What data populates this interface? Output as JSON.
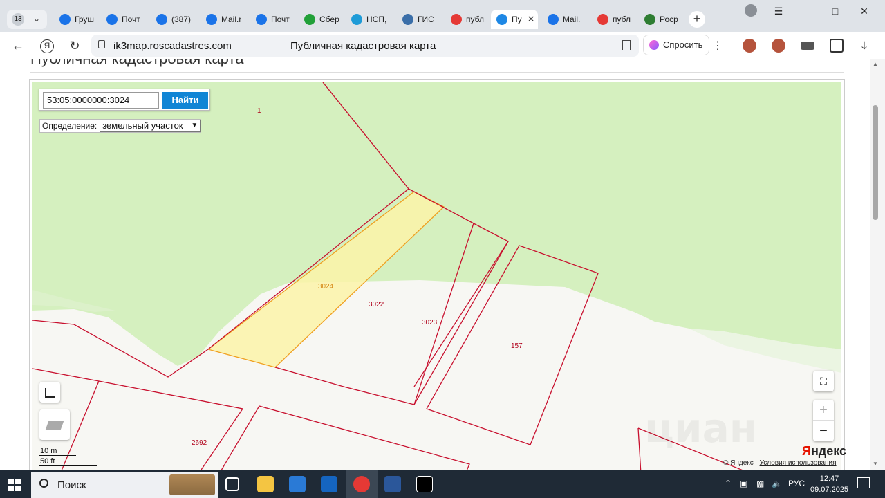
{
  "browser": {
    "tab_count": "13",
    "tabs": [
      {
        "label": "Груш",
        "color": "#1a73e8"
      },
      {
        "label": "Почт",
        "color": "#1a73e8"
      },
      {
        "label": "(387)",
        "color": "#1a73e8"
      },
      {
        "label": "Mail.r",
        "color": "#1a73e8"
      },
      {
        "label": "Почт",
        "color": "#1a73e8"
      },
      {
        "label": "Сбер",
        "color": "#21a038"
      },
      {
        "label": "НСП,",
        "color": "#1e9bd7"
      },
      {
        "label": "ГИС",
        "color": "#3a6ea8"
      },
      {
        "label": "публ",
        "color": "#e53935"
      },
      {
        "label": "Пу",
        "color": "#1e88e5",
        "active": true
      },
      {
        "label": "Mail.",
        "color": "#1a73e8"
      },
      {
        "label": "публ",
        "color": "#e53935"
      },
      {
        "label": "Роср",
        "color": "#2e7d32"
      }
    ],
    "url": "ik3map.roscadastres.com",
    "page_title": "Публичная кадастровая карта",
    "ask_label": "Спросить"
  },
  "page": {
    "heading": "Публичная кадастровая карта"
  },
  "search": {
    "value": "53:05:0000000:3024",
    "button_label": "Найти",
    "definition_label": "Определение:",
    "definition_value": "земельный участок"
  },
  "map": {
    "parcels": [
      {
        "label": "1"
      },
      {
        "label": "3024",
        "selected": true
      },
      {
        "label": "3022"
      },
      {
        "label": "3023"
      },
      {
        "label": "157"
      },
      {
        "label": "2692"
      }
    ],
    "scale_m": "10 m",
    "scale_ft": "50 ft",
    "logo": "Яндекс",
    "copyright": "© Яндекс",
    "terms": "Условия использования",
    "watermark": "циан",
    "colors": {
      "forest": "#d5f0bf",
      "parcel_border": "#c8102e",
      "selected_fill": "#fbf3a8",
      "selected_border": "#f0a020"
    }
  },
  "taskbar": {
    "search_label": "Поиск",
    "lang": "РУС",
    "time": "12:47",
    "date": "09.07.2025"
  }
}
